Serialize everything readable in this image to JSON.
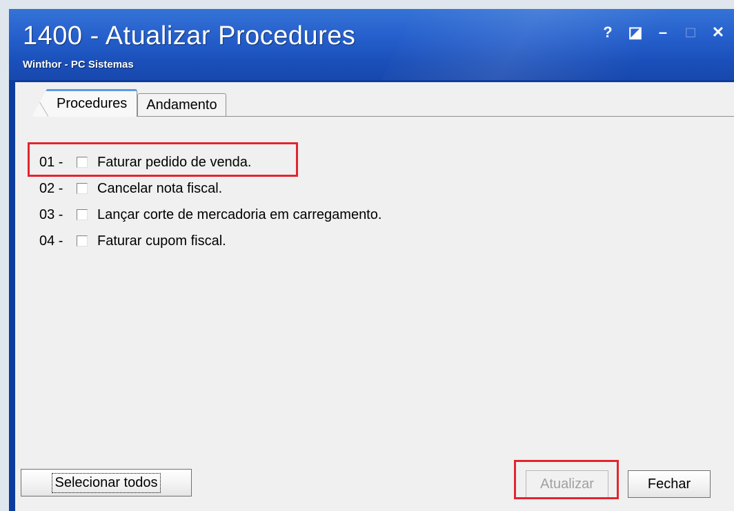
{
  "window": {
    "title": "1400 - Atualizar Procedures",
    "subtitle": "Winthor - PC Sistemas",
    "buttons": {
      "help": "?",
      "restore": "◪",
      "minimize": "–",
      "maximize": "□",
      "close": "✕"
    }
  },
  "tabs": [
    {
      "label": "Procedures",
      "active": true
    },
    {
      "label": "Andamento",
      "active": false
    }
  ],
  "procedures": [
    {
      "number": "01 -",
      "label": "Faturar pedido de venda.",
      "checked": false
    },
    {
      "number": "02 -",
      "label": "Cancelar nota fiscal.",
      "checked": false
    },
    {
      "number": "03 -",
      "label": "Lançar corte de mercadoria em carregamento.",
      "checked": false
    },
    {
      "number": "04 -",
      "label": "Faturar cupom fiscal.",
      "checked": false
    }
  ],
  "footer": {
    "select_all": "Selecionar todos",
    "update": "Atualizar",
    "close": "Fechar"
  },
  "colors": {
    "title_bar": "#255fcc",
    "highlight": "#e2242e",
    "client_bg": "#f0f0f0"
  }
}
